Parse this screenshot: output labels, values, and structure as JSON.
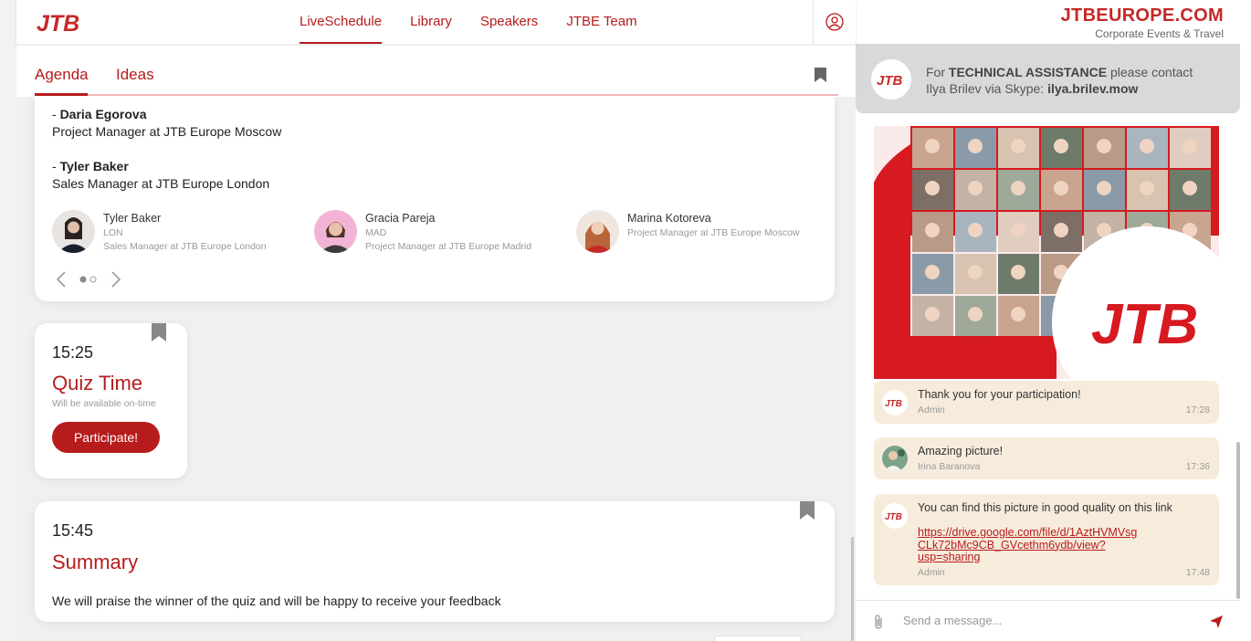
{
  "header": {
    "logo_text": "JTB",
    "nav": [
      {
        "label": "LiveSchedule",
        "active": true
      },
      {
        "label": "Library",
        "active": false
      },
      {
        "label": "Speakers",
        "active": false
      },
      {
        "label": "JTBE Team",
        "active": false
      }
    ],
    "user_icon": "user-circle-icon"
  },
  "tabs": [
    {
      "label": "Agenda",
      "active": true
    },
    {
      "label": "Ideas",
      "active": false
    }
  ],
  "session": {
    "speaker_lines": [
      {
        "prefix": "- ",
        "name": "Daria Egorova",
        "role": "Project Manager at JTB Europe Moscow"
      },
      {
        "prefix": "- ",
        "name": "Tyler Baker",
        "role": "Sales Manager at JTB Europe London"
      }
    ],
    "speakers": [
      {
        "name": "Tyler Baker",
        "code": "LON",
        "role": "Sales Manager at JTB Europe London"
      },
      {
        "name": "Gracia Pareja",
        "code": "MAD",
        "role": "Project Manager at JTB Europe Madrid"
      },
      {
        "name": "Marina Kotoreva",
        "code": "",
        "role": "Project Manager at JTB Europe Moscow"
      }
    ],
    "pager": {
      "pages": 2,
      "current": 1
    }
  },
  "quiz": {
    "time": "15:25",
    "title": "Quiz Time",
    "note": "Will be available on-time",
    "button": "Participate!"
  },
  "summary": {
    "time": "15:45",
    "title": "Summary",
    "description": "We will praise the winner of the quiz and will be happy to receive your feedback"
  },
  "brand": {
    "name": "JTBEUROPE.COM",
    "subtitle": "Corporate Events & Travel"
  },
  "tech_notice": {
    "pre": "For ",
    "strong1": "TECHNICAL ASSISTANCE",
    "mid": " please contact",
    "line2": "Ilya Brilev via Skype: ",
    "strong2": "ilya.brilev.mow"
  },
  "chat": {
    "image_logo_text": "JTB",
    "messages": [
      {
        "text": "Thank you for your participation!",
        "author": "Admin",
        "time": "17:28"
      },
      {
        "text": "Amazing picture!",
        "author": "Irina Baranova",
        "time": "17:36"
      },
      {
        "text": "You can find this picture in good quality on this link",
        "link_lines": [
          "https://drive.google.com/file/d/1AztHVMVsg",
          "CLk72bMc9CB_GVcethm6ydb/view?",
          "usp=sharing"
        ],
        "author": "Admin",
        "time": "17:48"
      }
    ],
    "composer_placeholder": "Send a message..."
  },
  "colors": {
    "accent": "#b71c1c",
    "brand": "#c62828",
    "message_bg": "#f7ecdc"
  }
}
